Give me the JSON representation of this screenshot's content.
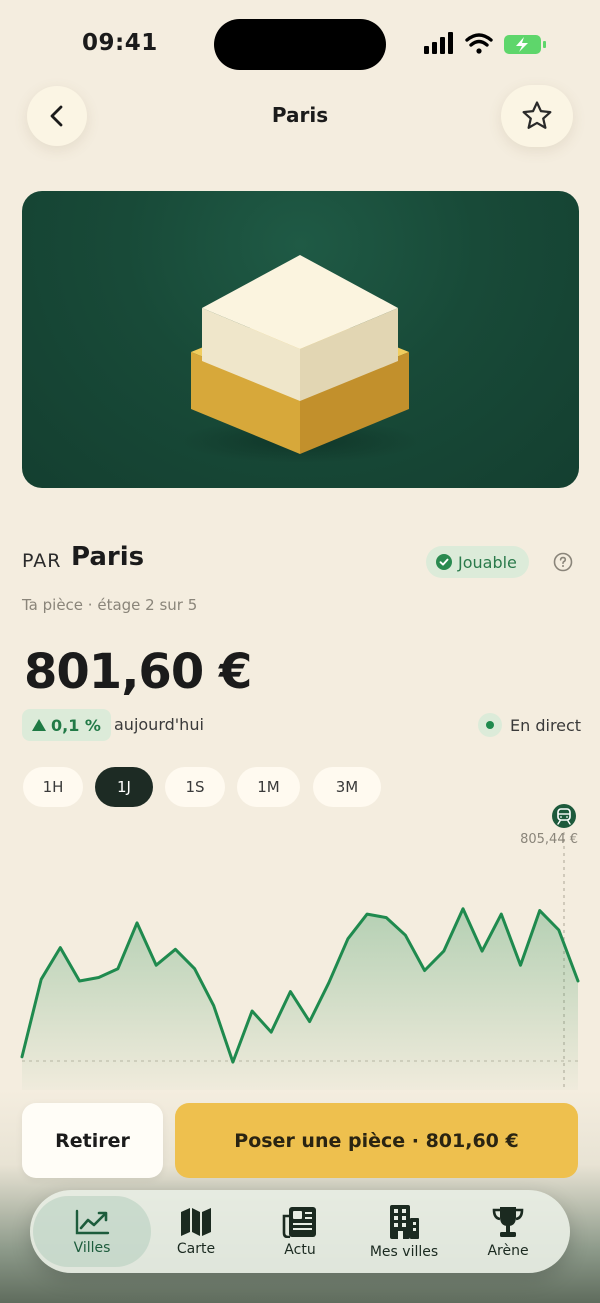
{
  "status_bar": {
    "time": "09:41"
  },
  "header": {
    "title": "Paris"
  },
  "summary": {
    "pair_label": "PAR",
    "city": "Paris",
    "badge": "Jouable",
    "subtitle": "Ta pièce · étage 2 sur 5",
    "price": "801,60 €",
    "change": "0,1 %",
    "change_direction": "up",
    "change_period": "aujourd'hui",
    "live_label": "En direct"
  },
  "ranges": [
    {
      "label": "1H",
      "active": false
    },
    {
      "label": "1J",
      "active": true
    },
    {
      "label": "1S",
      "active": false
    },
    {
      "label": "1M",
      "active": false
    },
    {
      "label": "3M",
      "active": false
    }
  ],
  "chart_data": {
    "type": "area",
    "max_label": "805,44 €",
    "values": [
      788.2,
      797.0,
      800.6,
      796.8,
      797.2,
      798.2,
      803.4,
      798.6,
      800.4,
      798.2,
      794.0,
      787.6,
      793.4,
      791.0,
      795.6,
      792.2,
      796.6,
      801.6,
      804.4,
      804.0,
      802.0,
      798.0,
      800.2,
      805.0,
      800.2,
      804.4,
      798.6,
      804.8,
      802.6,
      796.8
    ]
  },
  "actions": {
    "withdraw": "Retirer",
    "place": "Poser une pièce · 801,60 €"
  },
  "tabs": [
    {
      "label": "Villes",
      "icon": "chart-line-icon",
      "active": true
    },
    {
      "label": "Carte",
      "icon": "map-icon",
      "active": false
    },
    {
      "label": "Actu",
      "icon": "newspaper-icon",
      "active": false
    },
    {
      "label": "Mes villes",
      "icon": "building-icon",
      "active": false
    },
    {
      "label": "Arène",
      "icon": "trophy-icon",
      "active": false
    }
  ],
  "colors": {
    "background": "#f4eddf",
    "accent_green": "#1f8a4e",
    "primary_button": "#eec04e",
    "hero": "#184a38"
  }
}
